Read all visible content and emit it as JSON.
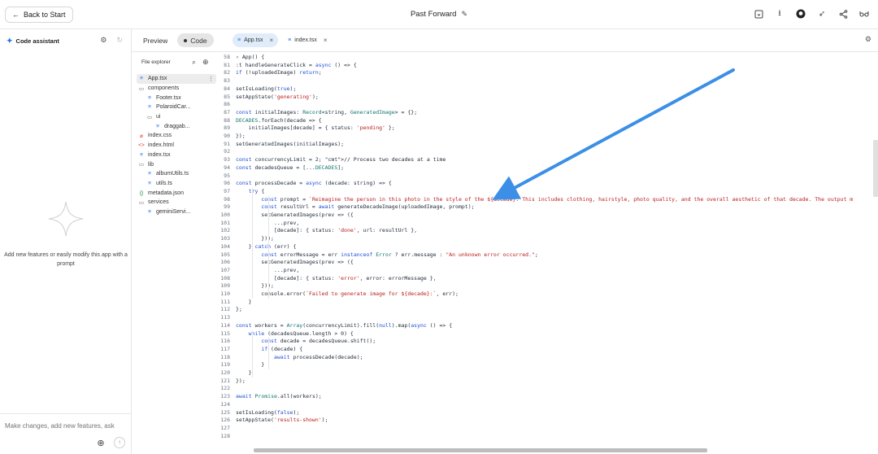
{
  "topbar": {
    "back_label": "Back to Start",
    "title": "Past Forward"
  },
  "assistant": {
    "title": "Code assistant",
    "empty_message": "Add new features or easily modify this app with a prompt",
    "input_placeholder": "Make changes, add new features, ask"
  },
  "view_toggle": [
    "Preview",
    "Code"
  ],
  "open_files": [
    {
      "name": "App.tsx",
      "active": true
    },
    {
      "name": "index.tsx",
      "active": false
    }
  ],
  "explorer": {
    "title": "File explorer",
    "items": [
      {
        "label": "App.tsx",
        "icon": "file-lines-icon",
        "indent": 0,
        "selected": true
      },
      {
        "label": "components",
        "icon": "folder-icon",
        "indent": 0
      },
      {
        "label": "Footer.tsx",
        "icon": "file-lines-icon",
        "indent": 1
      },
      {
        "label": "PolaroidCar...",
        "icon": "file-lines-icon",
        "indent": 1
      },
      {
        "label": "ui",
        "icon": "folder-icon",
        "indent": 1
      },
      {
        "label": "draggab...",
        "icon": "file-lines-icon",
        "indent": 2
      },
      {
        "label": "index.css",
        "icon": "css-icon",
        "indent": 0
      },
      {
        "label": "index.html",
        "icon": "html-icon",
        "indent": 0
      },
      {
        "label": "index.tsx",
        "icon": "file-lines-icon",
        "indent": 0
      },
      {
        "label": "lib",
        "icon": "folder-icon",
        "indent": 0
      },
      {
        "label": "albumUtils.ts",
        "icon": "file-lines-icon",
        "indent": 1
      },
      {
        "label": "utils.ts",
        "icon": "file-lines-icon",
        "indent": 1
      },
      {
        "label": "metadata.json",
        "icon": "json-icon",
        "indent": 0
      },
      {
        "label": "services",
        "icon": "folder-icon",
        "indent": 0
      },
      {
        "label": "geminiServi...",
        "icon": "file-lines-icon",
        "indent": 1
      }
    ]
  },
  "code_lines": [
    {
      "n": "58",
      "t": "› App() {"
    },
    {
      "n": "81",
      "t": ":t handleGenerateClick = async () => {"
    },
    {
      "n": "82",
      "t": "if (!uploadedImage) return;"
    },
    {
      "n": "83",
      "t": ""
    },
    {
      "n": "84",
      "t": "setIsLoading(true);"
    },
    {
      "n": "85",
      "t": "setAppState('generating');"
    },
    {
      "n": "86",
      "t": ""
    },
    {
      "n": "87",
      "t": "const initialImages: Record<string, GeneratedImage> = {};"
    },
    {
      "n": "88",
      "t": "DECADES.forEach(decade => {"
    },
    {
      "n": "89",
      "t": "    initialImages[decade] = { status: 'pending' };"
    },
    {
      "n": "90",
      "t": "});"
    },
    {
      "n": "91",
      "t": "setGeneratedImages(initialImages);"
    },
    {
      "n": "92",
      "t": ""
    },
    {
      "n": "93",
      "t": "const concurrencyLimit = 2; // Process two decades at a time"
    },
    {
      "n": "94",
      "t": "const decadesQueue = [...DECADES];"
    },
    {
      "n": "95",
      "t": ""
    },
    {
      "n": "96",
      "t": "const processDecade = async (decade: string) => {"
    },
    {
      "n": "97",
      "t": "    try {"
    },
    {
      "n": "98",
      "t": "        const prompt = `Reimagine the person in this photo in the style of the ${decade}. This includes clothing, hairstyle, photo quality, and the overall aesthetic of that decade. The output m"
    },
    {
      "n": "99",
      "t": "        const resultUrl = await generateDecadeImage(uploadedImage, prompt);"
    },
    {
      "n": "100",
      "t": "        setGeneratedImages(prev => ({"
    },
    {
      "n": "101",
      "t": "            ...prev,"
    },
    {
      "n": "102",
      "t": "            [decade]: { status: 'done', url: resultUrl },"
    },
    {
      "n": "103",
      "t": "        }));"
    },
    {
      "n": "104",
      "t": "    } catch (err) {"
    },
    {
      "n": "105",
      "t": "        const errorMessage = err instanceof Error ? err.message : \"An unknown error occurred.\";"
    },
    {
      "n": "106",
      "t": "        setGeneratedImages(prev => ({"
    },
    {
      "n": "107",
      "t": "            ...prev,"
    },
    {
      "n": "108",
      "t": "            [decade]: { status: 'error', error: errorMessage },"
    },
    {
      "n": "109",
      "t": "        }));"
    },
    {
      "n": "110",
      "t": "        console.error(`Failed to generate image for ${decade}:`, err);"
    },
    {
      "n": "111",
      "t": "    }"
    },
    {
      "n": "112",
      "t": "};"
    },
    {
      "n": "113",
      "t": ""
    },
    {
      "n": "114",
      "t": "const workers = Array(concurrencyLimit).fill(null).map(async () => {"
    },
    {
      "n": "115",
      "t": "    while (decadesQueue.length > 0) {"
    },
    {
      "n": "116",
      "t": "        const decade = decadesQueue.shift();"
    },
    {
      "n": "117",
      "t": "        if (decade) {"
    },
    {
      "n": "118",
      "t": "            await processDecade(decade);"
    },
    {
      "n": "119",
      "t": "        }"
    },
    {
      "n": "120",
      "t": "    }"
    },
    {
      "n": "121",
      "t": "});"
    },
    {
      "n": "122",
      "t": ""
    },
    {
      "n": "123",
      "t": "await Promise.all(workers);"
    },
    {
      "n": "124",
      "t": ""
    },
    {
      "n": "125",
      "t": "setIsLoading(false);"
    },
    {
      "n": "126",
      "t": "setAppState('results-shown');"
    },
    {
      "n": "127",
      "t": ""
    },
    {
      "n": "128",
      "t": ""
    }
  ],
  "colors": {
    "accent": "#1a73e8",
    "arrow": "#3b8fe6"
  }
}
